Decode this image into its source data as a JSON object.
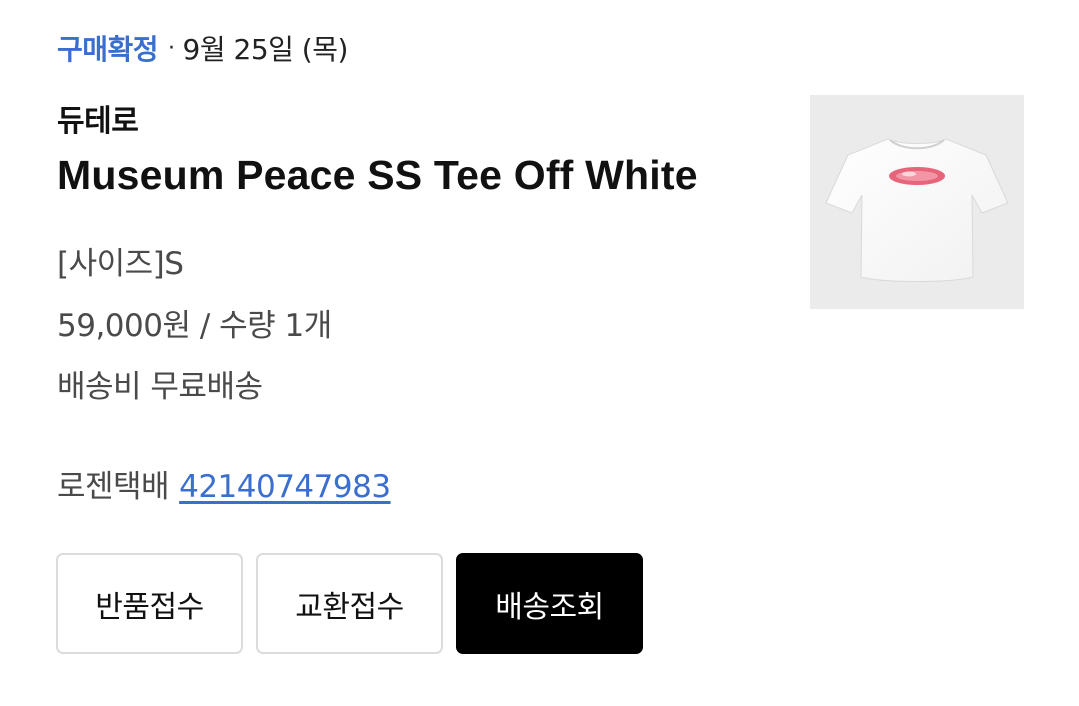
{
  "order": {
    "status": "구매확정",
    "separator": "·",
    "date": "9월 25일 (목)"
  },
  "product": {
    "brand": "듀테로",
    "name": "Museum Peace SS Tee Off White",
    "option": "[사이즈]S",
    "price_qty": "59,000원 / 수량 1개",
    "shipping_fee": "배송비 무료배송",
    "thumbnail_icon": "white-tshirt-with-pink-oval-logo"
  },
  "delivery": {
    "courier": "로젠택배",
    "tracking_number": "42140747983"
  },
  "actions": {
    "return_label": "반품접수",
    "exchange_label": "교환접수",
    "track_label": "배송조회"
  },
  "colors": {
    "status": "#3a6fd0",
    "link": "#3a6fd0",
    "primary_button": "#000000",
    "thumbnail_bg": "#ebebeb",
    "logo_pink": "#e8647a"
  }
}
